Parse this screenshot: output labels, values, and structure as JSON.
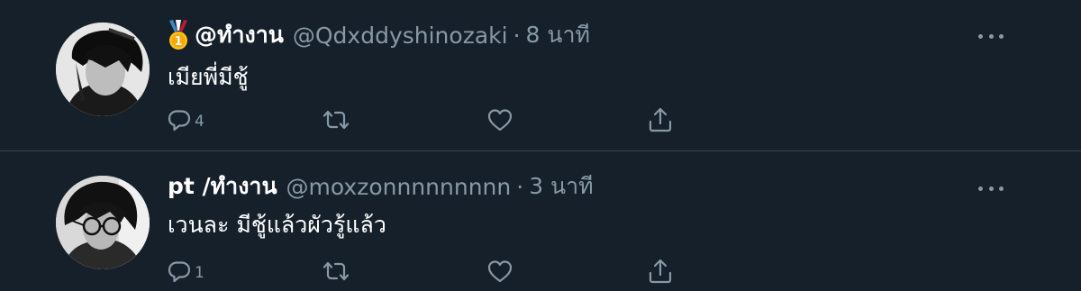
{
  "tweets": [
    {
      "display_name": "@ทำงาน",
      "has_medal": true,
      "handle": "@Qdxddyshinozaki",
      "time": "8 นาที",
      "text": "เมียพี่มีชู้",
      "reply_count": "4",
      "avatar_icon": "profile-photo"
    },
    {
      "display_name": "pt /ทำงาน",
      "has_medal": false,
      "handle": "@moxzonnnnnnnnn",
      "time": "3 นาที",
      "text": "เวนละ มีชู้แล้วผัวรู้แล้ว",
      "reply_count": "1",
      "avatar_icon": "profile-photo"
    }
  ],
  "separator": "·",
  "icons": {
    "reply": "reply-icon",
    "retweet": "retweet-icon",
    "like": "like-icon",
    "share": "share-icon",
    "more": "more-icon",
    "medal": "medal-icon"
  },
  "colors": {
    "background": "#15202b",
    "secondary_text": "#8899a6",
    "divider": "#38444d"
  }
}
